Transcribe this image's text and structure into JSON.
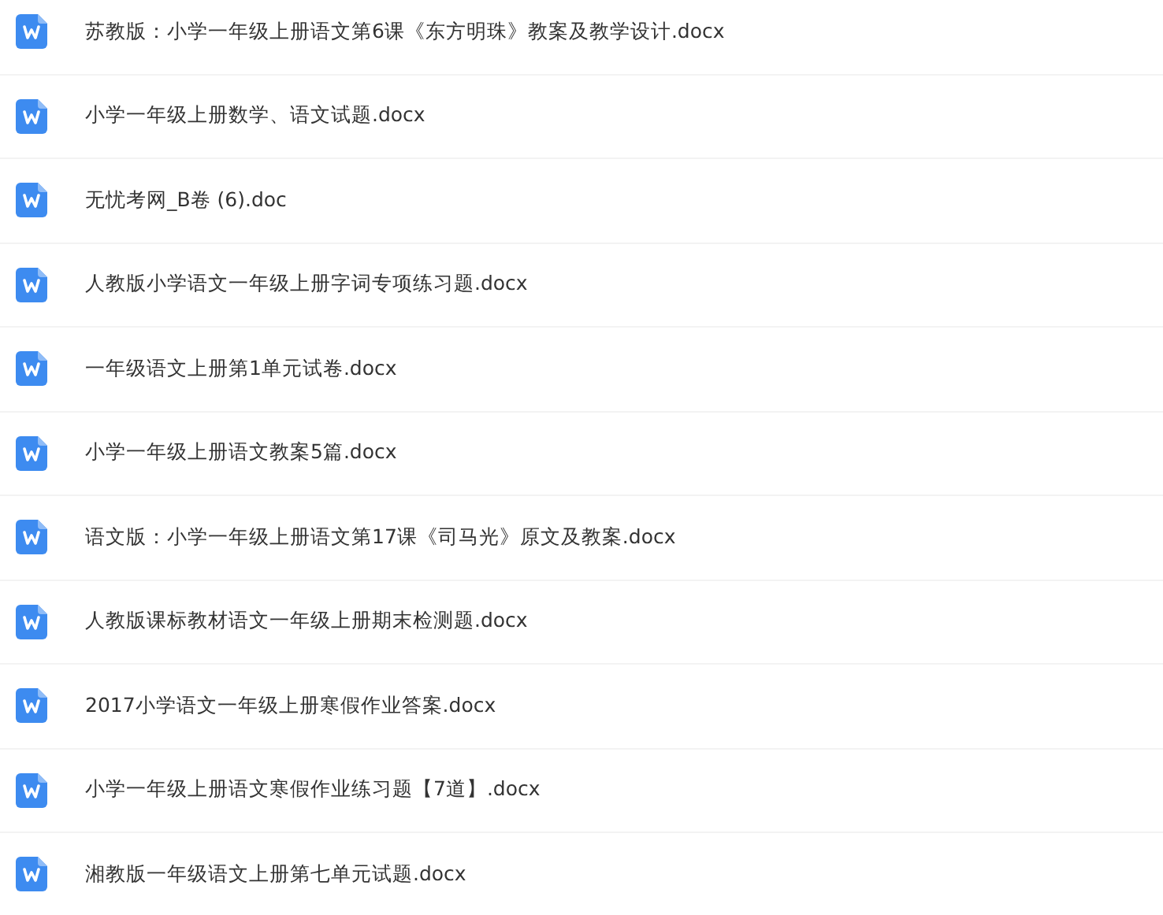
{
  "files": [
    {
      "name": "苏教版：小学一年级上册语文第6课《东方明珠》教案及教学设计.docx"
    },
    {
      "name": "小学一年级上册数学、语文试题.docx"
    },
    {
      "name": "无忧考网_B卷 (6).doc"
    },
    {
      "name": "人教版小学语文一年级上册字词专项练习题.docx"
    },
    {
      "name": "一年级语文上册第1单元试卷.docx"
    },
    {
      "name": "小学一年级上册语文教案5篇.docx"
    },
    {
      "name": "语文版：小学一年级上册语文第17课《司马光》原文及教案.docx"
    },
    {
      "name": "人教版课标教材语文一年级上册期末检测题.docx"
    },
    {
      "name": "2017小学语文一年级上册寒假作业答案.docx"
    },
    {
      "name": "小学一年级上册语文寒假作业练习题【7道】.docx"
    },
    {
      "name": "湘教版一年级语文上册第七单元试题.docx"
    }
  ]
}
